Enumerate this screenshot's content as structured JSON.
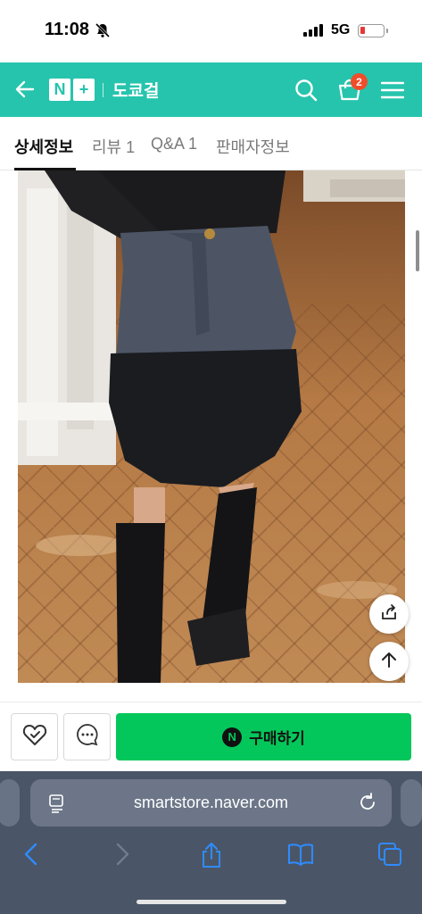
{
  "status_bar": {
    "time": "11:08",
    "network": "5G"
  },
  "header": {
    "logo_letter": "N",
    "logo_plus": "+",
    "store_name": "도쿄걸",
    "cart_count": "2"
  },
  "tabs": [
    {
      "label": "상세정보",
      "active": true
    },
    {
      "label": "리뷰 1",
      "active": false
    },
    {
      "label": "Q&A 1",
      "active": false
    },
    {
      "label": "판매자정보",
      "active": false
    }
  ],
  "purchase": {
    "buy_icon_letter": "N",
    "buy_label": "구매하기"
  },
  "browser": {
    "url": "smartstore.naver.com"
  },
  "colors": {
    "header_bg": "#26c4ad",
    "buy_button": "#03c75a",
    "cart_badge": "#f04d2a",
    "browser_bg": "#4a5667"
  },
  "icons": [
    "bell-slash-icon",
    "back-arrow-icon",
    "search-icon",
    "cart-icon",
    "menu-icon",
    "share-icon",
    "arrow-up-icon",
    "heart-icon",
    "chat-icon",
    "reader-icon",
    "reload-icon",
    "chevron-left-icon",
    "chevron-right-icon",
    "share-up-icon",
    "book-icon",
    "tabs-icon"
  ]
}
